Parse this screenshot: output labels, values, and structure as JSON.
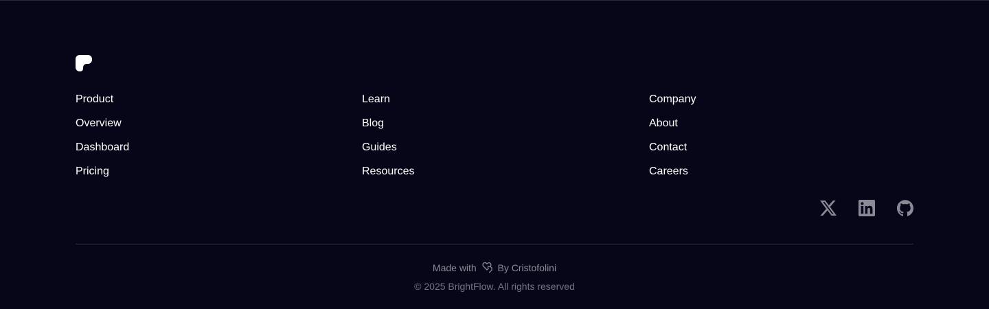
{
  "logo": {
    "icon": "brightflow-logo-icon",
    "color": "#ffffff"
  },
  "columns": [
    {
      "heading": "Product",
      "links": [
        "Overview",
        "Dashboard",
        "Pricing"
      ]
    },
    {
      "heading": "Learn",
      "links": [
        "Blog",
        "Guides",
        "Resources"
      ]
    },
    {
      "heading": "Company",
      "links": [
        "About",
        "Contact",
        "Careers"
      ]
    }
  ],
  "social": [
    {
      "icon": "x-twitter-icon"
    },
    {
      "icon": "linkedin-icon"
    },
    {
      "icon": "github-icon"
    }
  ],
  "footer": {
    "made_with": "Made with",
    "author": "By Cristofolini",
    "copyright": "© 2025 BrightFlow. All rights reserved"
  },
  "colors": {
    "background": "#070618",
    "text": "#ffffff",
    "muted": "#8b8b98",
    "divider": "#2f2e44"
  }
}
